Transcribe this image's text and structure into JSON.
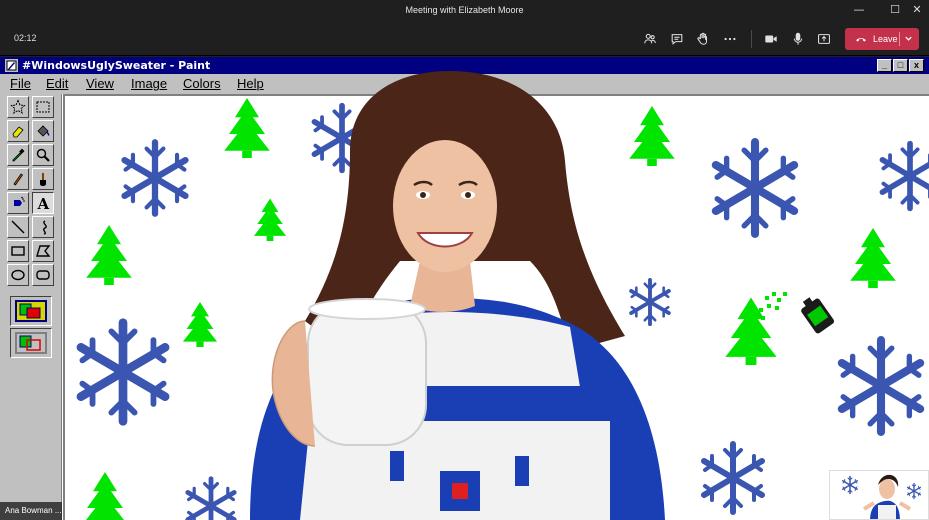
{
  "window": {
    "title": "Meeting with Elizabeth Moore",
    "minimize_glyph": "—",
    "maximize_glyph": "☐",
    "close_glyph": "✕"
  },
  "meeting": {
    "timer": "02:12",
    "leave_label": "Leave",
    "icons": [
      "people-icon",
      "chat-icon",
      "raise-hand-icon",
      "more-icon",
      "camera-icon",
      "mic-icon",
      "share-icon"
    ]
  },
  "paint": {
    "title": "#WindowsUglySweater - Paint",
    "menu": [
      "File",
      "Edit",
      "View",
      "Image",
      "Colors",
      "Help"
    ],
    "tools": [
      "free-select",
      "rect-select",
      "eraser",
      "fill",
      "color-picker",
      "magnifier",
      "pencil",
      "brush",
      "airbrush",
      "text",
      "line",
      "curve",
      "rectangle",
      "polygon",
      "ellipse",
      "rounded-rect"
    ],
    "tree_color": "#00e400",
    "snowflake_color": "#3a56b0"
  },
  "participants": {
    "self_name": "Ana Bowman",
    "self_more": "..."
  }
}
